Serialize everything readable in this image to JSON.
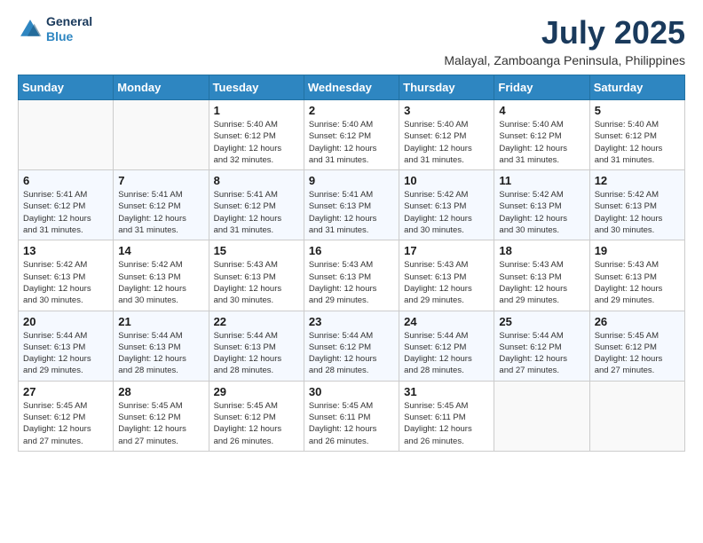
{
  "header": {
    "logo_line1": "General",
    "logo_line2": "Blue",
    "title": "July 2025",
    "location": "Malayal, Zamboanga Peninsula, Philippines"
  },
  "weekdays": [
    "Sunday",
    "Monday",
    "Tuesday",
    "Wednesday",
    "Thursday",
    "Friday",
    "Saturday"
  ],
  "weeks": [
    [
      {
        "day": "",
        "info": ""
      },
      {
        "day": "",
        "info": ""
      },
      {
        "day": "1",
        "info": "Sunrise: 5:40 AM\nSunset: 6:12 PM\nDaylight: 12 hours\nand 32 minutes."
      },
      {
        "day": "2",
        "info": "Sunrise: 5:40 AM\nSunset: 6:12 PM\nDaylight: 12 hours\nand 31 minutes."
      },
      {
        "day": "3",
        "info": "Sunrise: 5:40 AM\nSunset: 6:12 PM\nDaylight: 12 hours\nand 31 minutes."
      },
      {
        "day": "4",
        "info": "Sunrise: 5:40 AM\nSunset: 6:12 PM\nDaylight: 12 hours\nand 31 minutes."
      },
      {
        "day": "5",
        "info": "Sunrise: 5:40 AM\nSunset: 6:12 PM\nDaylight: 12 hours\nand 31 minutes."
      }
    ],
    [
      {
        "day": "6",
        "info": "Sunrise: 5:41 AM\nSunset: 6:12 PM\nDaylight: 12 hours\nand 31 minutes."
      },
      {
        "day": "7",
        "info": "Sunrise: 5:41 AM\nSunset: 6:12 PM\nDaylight: 12 hours\nand 31 minutes."
      },
      {
        "day": "8",
        "info": "Sunrise: 5:41 AM\nSunset: 6:12 PM\nDaylight: 12 hours\nand 31 minutes."
      },
      {
        "day": "9",
        "info": "Sunrise: 5:41 AM\nSunset: 6:13 PM\nDaylight: 12 hours\nand 31 minutes."
      },
      {
        "day": "10",
        "info": "Sunrise: 5:42 AM\nSunset: 6:13 PM\nDaylight: 12 hours\nand 30 minutes."
      },
      {
        "day": "11",
        "info": "Sunrise: 5:42 AM\nSunset: 6:13 PM\nDaylight: 12 hours\nand 30 minutes."
      },
      {
        "day": "12",
        "info": "Sunrise: 5:42 AM\nSunset: 6:13 PM\nDaylight: 12 hours\nand 30 minutes."
      }
    ],
    [
      {
        "day": "13",
        "info": "Sunrise: 5:42 AM\nSunset: 6:13 PM\nDaylight: 12 hours\nand 30 minutes."
      },
      {
        "day": "14",
        "info": "Sunrise: 5:42 AM\nSunset: 6:13 PM\nDaylight: 12 hours\nand 30 minutes."
      },
      {
        "day": "15",
        "info": "Sunrise: 5:43 AM\nSunset: 6:13 PM\nDaylight: 12 hours\nand 30 minutes."
      },
      {
        "day": "16",
        "info": "Sunrise: 5:43 AM\nSunset: 6:13 PM\nDaylight: 12 hours\nand 29 minutes."
      },
      {
        "day": "17",
        "info": "Sunrise: 5:43 AM\nSunset: 6:13 PM\nDaylight: 12 hours\nand 29 minutes."
      },
      {
        "day": "18",
        "info": "Sunrise: 5:43 AM\nSunset: 6:13 PM\nDaylight: 12 hours\nand 29 minutes."
      },
      {
        "day": "19",
        "info": "Sunrise: 5:43 AM\nSunset: 6:13 PM\nDaylight: 12 hours\nand 29 minutes."
      }
    ],
    [
      {
        "day": "20",
        "info": "Sunrise: 5:44 AM\nSunset: 6:13 PM\nDaylight: 12 hours\nand 29 minutes."
      },
      {
        "day": "21",
        "info": "Sunrise: 5:44 AM\nSunset: 6:13 PM\nDaylight: 12 hours\nand 28 minutes."
      },
      {
        "day": "22",
        "info": "Sunrise: 5:44 AM\nSunset: 6:13 PM\nDaylight: 12 hours\nand 28 minutes."
      },
      {
        "day": "23",
        "info": "Sunrise: 5:44 AM\nSunset: 6:12 PM\nDaylight: 12 hours\nand 28 minutes."
      },
      {
        "day": "24",
        "info": "Sunrise: 5:44 AM\nSunset: 6:12 PM\nDaylight: 12 hours\nand 28 minutes."
      },
      {
        "day": "25",
        "info": "Sunrise: 5:44 AM\nSunset: 6:12 PM\nDaylight: 12 hours\nand 27 minutes."
      },
      {
        "day": "26",
        "info": "Sunrise: 5:45 AM\nSunset: 6:12 PM\nDaylight: 12 hours\nand 27 minutes."
      }
    ],
    [
      {
        "day": "27",
        "info": "Sunrise: 5:45 AM\nSunset: 6:12 PM\nDaylight: 12 hours\nand 27 minutes."
      },
      {
        "day": "28",
        "info": "Sunrise: 5:45 AM\nSunset: 6:12 PM\nDaylight: 12 hours\nand 27 minutes."
      },
      {
        "day": "29",
        "info": "Sunrise: 5:45 AM\nSunset: 6:12 PM\nDaylight: 12 hours\nand 26 minutes."
      },
      {
        "day": "30",
        "info": "Sunrise: 5:45 AM\nSunset: 6:11 PM\nDaylight: 12 hours\nand 26 minutes."
      },
      {
        "day": "31",
        "info": "Sunrise: 5:45 AM\nSunset: 6:11 PM\nDaylight: 12 hours\nand 26 minutes."
      },
      {
        "day": "",
        "info": ""
      },
      {
        "day": "",
        "info": ""
      }
    ]
  ]
}
